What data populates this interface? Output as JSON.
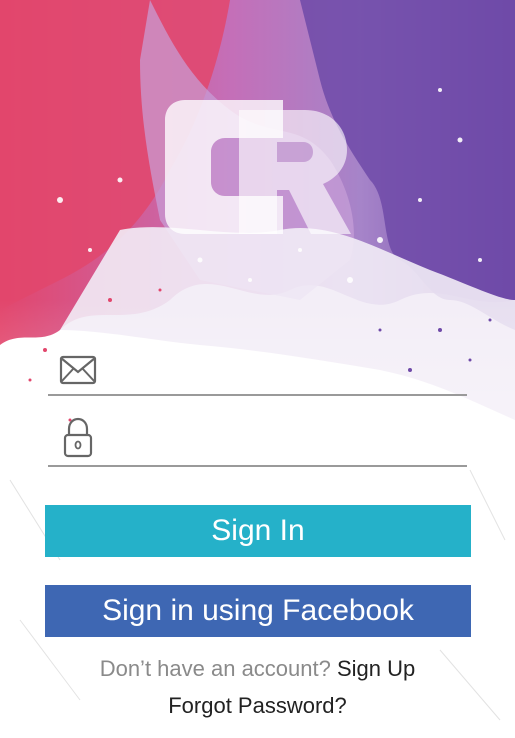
{
  "app": {
    "logo_letters": "CR"
  },
  "colors": {
    "signin_button": "#25b1c9",
    "facebook_button": "#3e67b3",
    "paint_pink": "#e2466c",
    "paint_purple": "#6f4aa8",
    "paint_lilac": "#b27fc4"
  },
  "form": {
    "email_icon": "envelope-icon",
    "email_value": "",
    "email_placeholder": "",
    "password_icon": "lock-icon",
    "password_value": "",
    "password_placeholder": ""
  },
  "buttons": {
    "signin_label": "Sign In",
    "facebook_label": "Sign in using Facebook"
  },
  "footer": {
    "no_account_text": "Don’t have an account?",
    "signup_label": "Sign Up",
    "forgot_label": "Forgot Password?"
  }
}
